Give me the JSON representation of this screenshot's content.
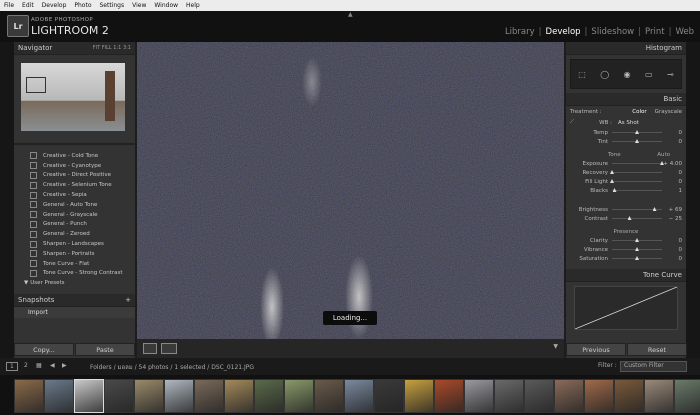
{
  "menu": [
    "File",
    "Edit",
    "Develop",
    "Photo",
    "Settings",
    "View",
    "Window",
    "Help"
  ],
  "app": {
    "logo": "Lr",
    "subtitle": "ADOBE PHOTOSHOP",
    "title": "LIGHTROOM 2"
  },
  "modules": [
    {
      "label": "Library",
      "active": false
    },
    {
      "label": "Develop",
      "active": true
    },
    {
      "label": "Slideshow",
      "active": false
    },
    {
      "label": "Print",
      "active": false
    },
    {
      "label": "Web",
      "active": false
    }
  ],
  "navigator": {
    "title": "Navigator",
    "zooms": "FIT  FILL  1:1  3:1"
  },
  "presets": [
    "Creative - Cold Tone",
    "Creative - Cyanotype",
    "Creative - Direct Positive",
    "Creative - Selenium Tone",
    "Creative - Sepia",
    "General - Auto Tone",
    "General - Grayscale",
    "General - Punch",
    "General - Zeroed",
    "Sharpen - Landscapes",
    "Sharpen - Portraits",
    "Tone Curve - Flat",
    "Tone Curve - Strong Contrast",
    "User Presets"
  ],
  "snapshots": {
    "title": "Snapshots",
    "import_label": "Import"
  },
  "left_buttons": {
    "copy": "Copy...",
    "paste": "Paste"
  },
  "loading": "Loading...",
  "histogram": {
    "title": "Histogram"
  },
  "basic": {
    "title": "Basic",
    "treatment_label": "Treatment :",
    "color": "Color",
    "grayscale": "Grayscale",
    "wb_label": "WB :",
    "wb_value": "As Shot",
    "wb_sliders": [
      {
        "label": "Temp",
        "value": "0",
        "pos": 0.5
      },
      {
        "label": "Tint",
        "value": "0",
        "pos": 0.5
      }
    ],
    "tone_label": "Tone",
    "auto_label": "Auto",
    "tone_sliders": [
      {
        "label": "Exposure",
        "value": "+ 4.00",
        "pos": 1.0
      },
      {
        "label": "Recovery",
        "value": "0",
        "pos": 0.0
      },
      {
        "label": "Fill Light",
        "value": "0",
        "pos": 0.0
      },
      {
        "label": "Blacks",
        "value": "1",
        "pos": 0.05
      }
    ],
    "bc_sliders": [
      {
        "label": "Brightness",
        "value": "+ 69",
        "pos": 0.85
      },
      {
        "label": "Contrast",
        "value": "− 25",
        "pos": 0.35
      }
    ],
    "presence_label": "Presence",
    "presence_sliders": [
      {
        "label": "Clarity",
        "value": "0",
        "pos": 0.5
      },
      {
        "label": "Vibrance",
        "value": "0",
        "pos": 0.5
      },
      {
        "label": "Saturation",
        "value": "0",
        "pos": 0.5
      }
    ]
  },
  "tone_curve": {
    "title": "Tone Curve"
  },
  "right_buttons": {
    "previous": "Previous",
    "reset": "Reset"
  },
  "filmbar": {
    "pages": [
      "1",
      "2"
    ],
    "path": "Folders / มอลม / 54 photos / 1 selected / DSC_0121.JPG",
    "filter_label": "Filter :",
    "filter_value": "Custom Filter"
  },
  "colors": {
    "accent": "#ffffff",
    "panel": "#333333"
  }
}
